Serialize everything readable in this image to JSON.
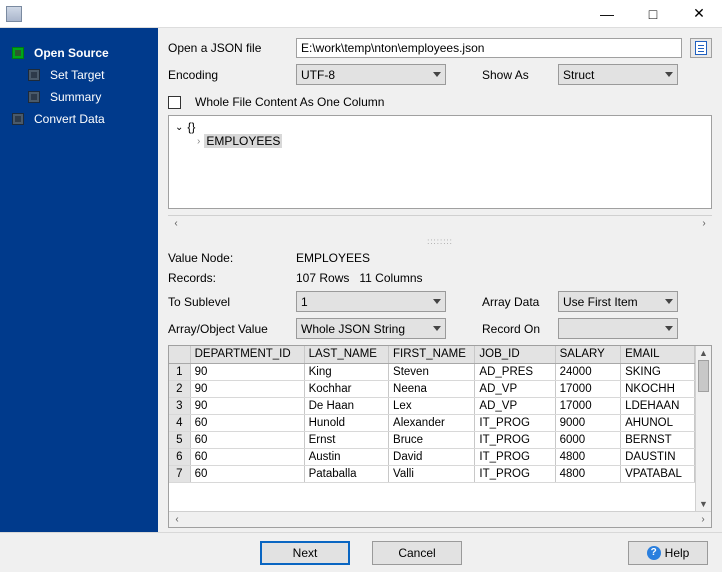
{
  "sidebar": {
    "items": [
      {
        "label": "Open Source",
        "active": true,
        "level": 1
      },
      {
        "label": "Set Target",
        "active": false,
        "level": 2
      },
      {
        "label": "Summary",
        "active": false,
        "level": 2
      },
      {
        "label": "Convert Data",
        "active": false,
        "level": 1
      }
    ]
  },
  "open_file_label": "Open a JSON file",
  "open_file_value": "E:\\work\\temp\\nton\\employees.json",
  "encoding_label": "Encoding",
  "encoding_value": "UTF-8",
  "show_as_label": "Show As",
  "show_as_value": "Struct",
  "whole_file_label": "Whole File Content As One Column",
  "tree": {
    "root": "{}",
    "node": "EMPLOYEES"
  },
  "value_node_label": "Value Node:",
  "value_node_value": "EMPLOYEES",
  "records_label": "Records:",
  "records_rows": "107 Rows",
  "records_cols": "11 Columns",
  "to_sublevel_label": "To Sublevel",
  "to_sublevel_value": "1",
  "array_data_label": "Array Data",
  "array_data_value": "Use First Item",
  "array_obj_label": "Array/Object Value",
  "array_obj_value": "Whole JSON String",
  "record_on_label": "Record On",
  "record_on_value": "",
  "grid": {
    "headers": [
      "DEPARTMENT_ID",
      "LAST_NAME",
      "FIRST_NAME",
      "JOB_ID",
      "SALARY",
      "EMAIL"
    ],
    "col_classes": [
      "col-dept",
      "col-last",
      "col-first",
      "col-job",
      "col-sal",
      "col-email"
    ],
    "rows": [
      [
        "1",
        "90",
        "King",
        "Steven",
        "AD_PRES",
        "24000",
        "SKING"
      ],
      [
        "2",
        "90",
        "Kochhar",
        "Neena",
        "AD_VP",
        "17000",
        "NKOCHH"
      ],
      [
        "3",
        "90",
        "De Haan",
        "Lex",
        "AD_VP",
        "17000",
        "LDEHAAN"
      ],
      [
        "4",
        "60",
        "Hunold",
        "Alexander",
        "IT_PROG",
        "9000",
        "AHUNOL"
      ],
      [
        "5",
        "60",
        "Ernst",
        "Bruce",
        "IT_PROG",
        "6000",
        "BERNST"
      ],
      [
        "6",
        "60",
        "Austin",
        "David",
        "IT_PROG",
        "4800",
        "DAUSTIN"
      ],
      [
        "7",
        "60",
        "Pataballa",
        "Valli",
        "IT_PROG",
        "4800",
        "VPATABAL"
      ]
    ]
  },
  "footer": {
    "next": "Next",
    "cancel": "Cancel",
    "help": "Help"
  }
}
